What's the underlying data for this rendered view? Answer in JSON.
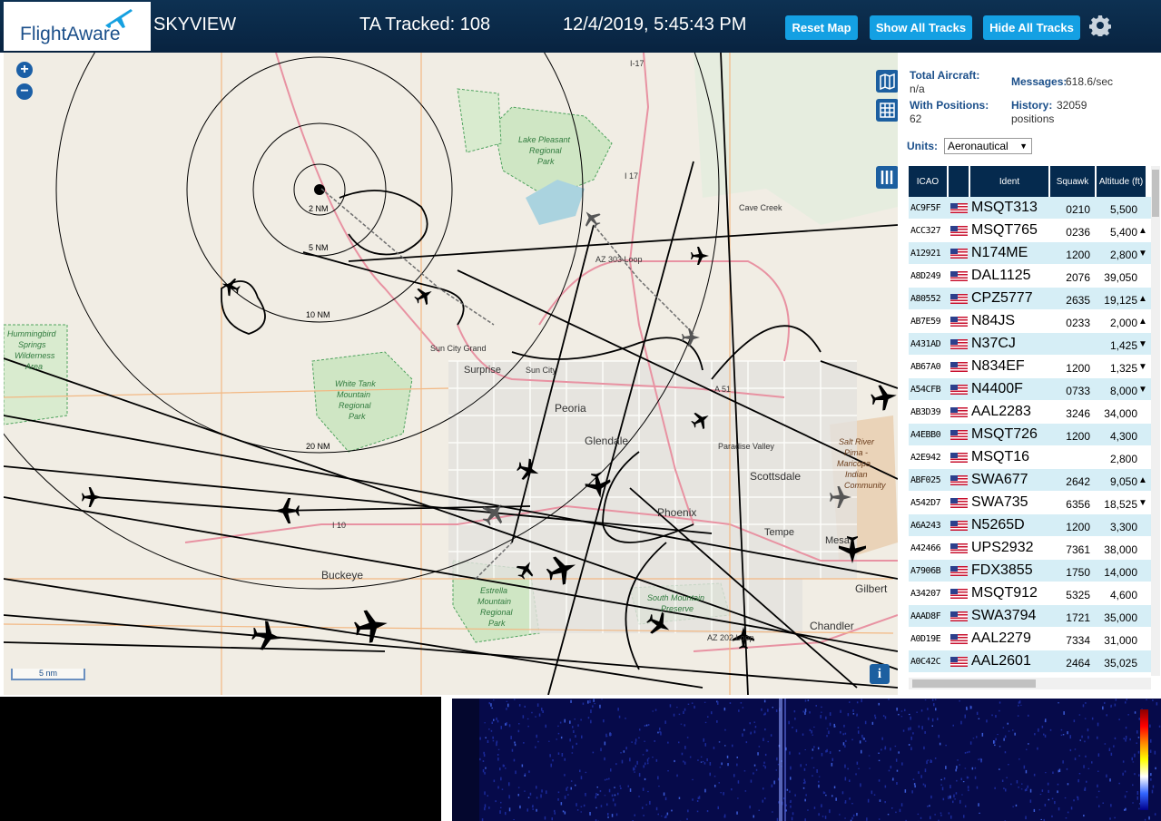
{
  "header": {
    "logo_text": "FlightAware",
    "app_name": "SKYVIEW",
    "tracked": "TA Tracked: 108",
    "datetime": "12/4/2019, 5:45:43 PM",
    "buttons": [
      "Reset Map",
      "Show All Tracks",
      "Hide All Tracks"
    ],
    "settings_icon": "gear-icon"
  },
  "map": {
    "zoom_in": "+",
    "zoom_out": "−",
    "scale_label": "5 nm",
    "info_label": "i",
    "range_rings": [
      "2 NM",
      "5 NM",
      "10 NM",
      "20 NM"
    ],
    "labels": [
      "Lake Pleasant",
      "Regional",
      "Park",
      "Cave Creek",
      "AZ 303 Loop",
      "I 17",
      "I-17",
      "Hummingbird",
      "Springs",
      "Wilderness",
      "Area",
      "Sun City Grand",
      "Surprise",
      "Sun City",
      "White Tank",
      "Mountain",
      "Regional",
      "Park",
      "Peoria",
      "A 51",
      "Glendale",
      "Paradise Valley",
      "Salt River",
      "Pima -",
      "Maricopa",
      "Indian",
      "Community",
      "Scottsdale",
      "Phoenix",
      "Tempe",
      "Mesa",
      "I 10",
      "Buckeye",
      "Estrella",
      "Mountain",
      "Regional",
      "Park",
      "South Mountain",
      "Preserve",
      "Gilbert",
      "Chandler",
      "AZ 202 Loop"
    ]
  },
  "stats": {
    "total_aircraft_label": "Total Aircraft:",
    "total_aircraft": "n/a",
    "messages_label": "Messages:",
    "messages": "618.6/sec",
    "with_positions_label": "With Positions:",
    "with_positions": "62",
    "history_label": "History:",
    "history_line1": "32059",
    "history_line2": "positions",
    "units_label": "Units:",
    "units_value": "Aeronautical"
  },
  "table": {
    "headers": [
      "ICAO",
      "",
      "Ident",
      "Squawk",
      "Altitude (ft)"
    ],
    "rows": [
      {
        "icao": "AC9F5F",
        "ident": "MSQT313",
        "squawk": "0210",
        "alt": "5,500",
        "trend": ""
      },
      {
        "icao": "ACC327",
        "ident": "MSQT765",
        "squawk": "0236",
        "alt": "5,400",
        "trend": "▲"
      },
      {
        "icao": "A12921",
        "ident": "N174ME",
        "squawk": "1200",
        "alt": "2,800",
        "trend": "▼"
      },
      {
        "icao": "A8D249",
        "ident": "DAL1125",
        "squawk": "2076",
        "alt": "39,050",
        "trend": ""
      },
      {
        "icao": "A80552",
        "ident": "CPZ5777",
        "squawk": "2635",
        "alt": "19,125",
        "trend": "▲"
      },
      {
        "icao": "AB7E59",
        "ident": "N84JS",
        "squawk": "0233",
        "alt": "2,000",
        "trend": "▲"
      },
      {
        "icao": "A431AD",
        "ident": "N37CJ",
        "squawk": "",
        "alt": "1,425",
        "trend": "▼"
      },
      {
        "icao": "AB67A0",
        "ident": "N834EF",
        "squawk": "1200",
        "alt": "1,325",
        "trend": "▼"
      },
      {
        "icao": "A54CFB",
        "ident": "N4400F",
        "squawk": "0733",
        "alt": "8,000",
        "trend": "▼"
      },
      {
        "icao": "AB3D39",
        "ident": "AAL2283",
        "squawk": "3246",
        "alt": "34,000",
        "trend": ""
      },
      {
        "icao": "A4EBB0",
        "ident": "MSQT726",
        "squawk": "1200",
        "alt": "4,300",
        "trend": ""
      },
      {
        "icao": "A2E942",
        "ident": "MSQT16",
        "squawk": "",
        "alt": "2,800",
        "trend": ""
      },
      {
        "icao": "ABF025",
        "ident": "SWA677",
        "squawk": "2642",
        "alt": "9,050",
        "trend": "▲"
      },
      {
        "icao": "A542D7",
        "ident": "SWA735",
        "squawk": "6356",
        "alt": "18,525",
        "trend": "▼"
      },
      {
        "icao": "A6A243",
        "ident": "N5265D",
        "squawk": "1200",
        "alt": "3,300",
        "trend": ""
      },
      {
        "icao": "A42466",
        "ident": "UPS2932",
        "squawk": "7361",
        "alt": "38,000",
        "trend": ""
      },
      {
        "icao": "A7906B",
        "ident": "FDX3855",
        "squawk": "1750",
        "alt": "14,000",
        "trend": ""
      },
      {
        "icao": "A34207",
        "ident": "MSQT912",
        "squawk": "5325",
        "alt": "4,600",
        "trend": ""
      },
      {
        "icao": "AAAD8F",
        "ident": "SWA3794",
        "squawk": "1721",
        "alt": "35,000",
        "trend": ""
      },
      {
        "icao": "A0D19E",
        "ident": "AAL2279",
        "squawk": "7334",
        "alt": "31,000",
        "trend": ""
      },
      {
        "icao": "A0C42C",
        "ident": "AAL2601",
        "squawk": "2464",
        "alt": "35,025",
        "trend": ""
      }
    ]
  }
}
